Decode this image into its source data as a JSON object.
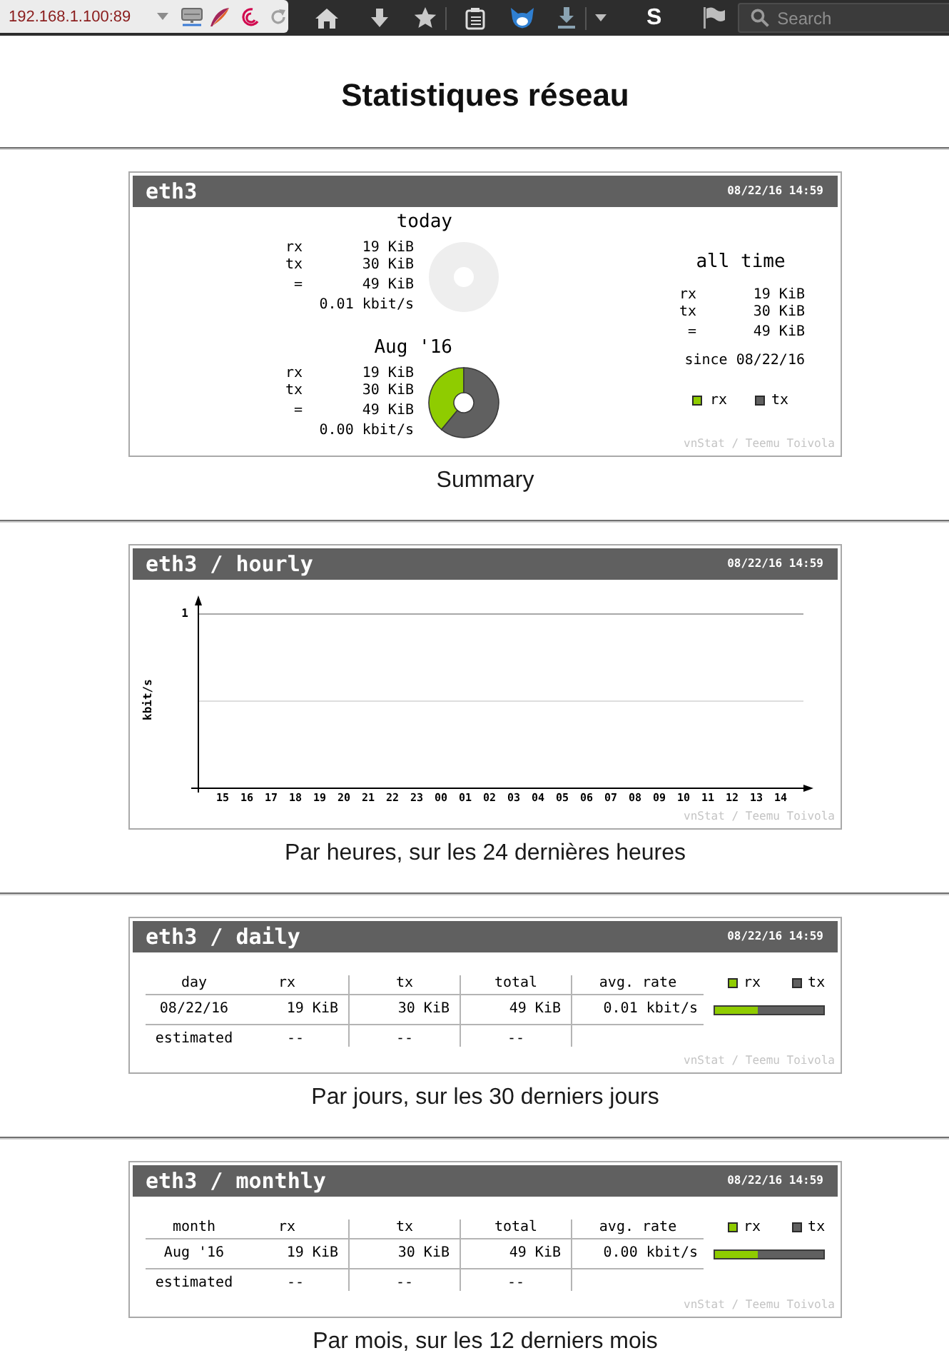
{
  "browser": {
    "url": "192.168.1.100:89",
    "extension_letter": "S",
    "search": {
      "placeholder": "Search"
    }
  },
  "title": "Statistiques réseau",
  "sections": [
    {
      "kind": "summary",
      "header": {
        "title": "eth3",
        "timestamp": "08/22/16 14:59"
      },
      "periods": [
        {
          "title": "today",
          "rows": [
            {
              "label": "rx",
              "value": "19 KiB"
            },
            {
              "label": "tx",
              "value": "30 KiB"
            },
            {
              "label": "=",
              "value": "49 KiB"
            }
          ],
          "rate": "0.01 kbit/s",
          "donut": {
            "filled": false
          }
        },
        {
          "title": "Aug '16",
          "rows": [
            {
              "label": "rx",
              "value": "19 KiB"
            },
            {
              "label": "tx",
              "value": "30 KiB"
            },
            {
              "label": "=",
              "value": "49 KiB"
            }
          ],
          "rate": "0.00 kbit/s",
          "donut": {
            "filled": true,
            "chart_data": {
              "type": "donut",
              "values": [
                39,
                61
              ]
            }
          }
        }
      ],
      "all_time": {
        "title": "all time",
        "rows": [
          {
            "label": "rx",
            "value": "19 KiB"
          },
          {
            "label": "tx",
            "value": "30 KiB"
          },
          {
            "label": "=",
            "value": "49 KiB"
          }
        ],
        "since": "since 08/22/16"
      },
      "legend": [
        {
          "label": "rx",
          "color": "#8fcc00"
        },
        {
          "label": "tx",
          "color": "#606060"
        }
      ],
      "credit": "vnStat / Teemu Toivola",
      "caption": "Summary"
    },
    {
      "kind": "hourly",
      "header": {
        "title": "eth3 / hourly",
        "timestamp": "08/22/16 14:59"
      },
      "graph": {
        "ylabel": "kbit/s",
        "scale_label": "1",
        "x_labels": [
          "15",
          "16",
          "17",
          "18",
          "19",
          "20",
          "21",
          "22",
          "23",
          "00",
          "01",
          "02",
          "03",
          "04",
          "05",
          "06",
          "07",
          "08",
          "09",
          "10",
          "11",
          "12",
          "13",
          "14"
        ]
      },
      "credit": "vnStat / Teemu Toivola",
      "caption": "Par heures, sur les 24 dernières heures"
    },
    {
      "kind": "table",
      "header": {
        "title": "eth3 / daily",
        "timestamp": "08/22/16 14:59"
      },
      "label_header": "day",
      "columns": [
        "rx",
        "tx",
        "total",
        "avg. rate"
      ],
      "rows": [
        {
          "kind": "data",
          "label": "08/22/16",
          "cells": [
            "19 KiB",
            "30 KiB",
            "49 KiB",
            "0.01 kbit/s"
          ],
          "level": 0.39
        },
        {
          "kind": "estimate",
          "label": "estimated",
          "cells": [
            "--",
            "--",
            "--"
          ]
        }
      ],
      "legend": [
        {
          "label": "rx",
          "color": "#8fcc00"
        },
        {
          "label": "tx",
          "color": "#606060"
        }
      ],
      "credit": "vnStat / Teemu Toivola",
      "caption": "Par jours, sur les 30 derniers jours"
    },
    {
      "kind": "table",
      "header": {
        "title": "eth3 / monthly",
        "timestamp": "08/22/16 14:59"
      },
      "label_header": "month",
      "columns": [
        "rx",
        "tx",
        "total",
        "avg. rate"
      ],
      "rows": [
        {
          "kind": "data",
          "label": "Aug '16",
          "cells": [
            "19 KiB",
            "30 KiB",
            "49 KiB",
            "0.00 kbit/s"
          ],
          "level": 0.39
        },
        {
          "kind": "estimate",
          "label": "estimated",
          "cells": [
            "--",
            "--",
            "--"
          ]
        }
      ],
      "legend": [
        {
          "label": "rx",
          "color": "#8fcc00"
        },
        {
          "label": "tx",
          "color": "#606060"
        }
      ],
      "credit": "vnStat / Teemu Toivola",
      "caption": "Par mois, sur les 12 derniers mois"
    }
  ]
}
